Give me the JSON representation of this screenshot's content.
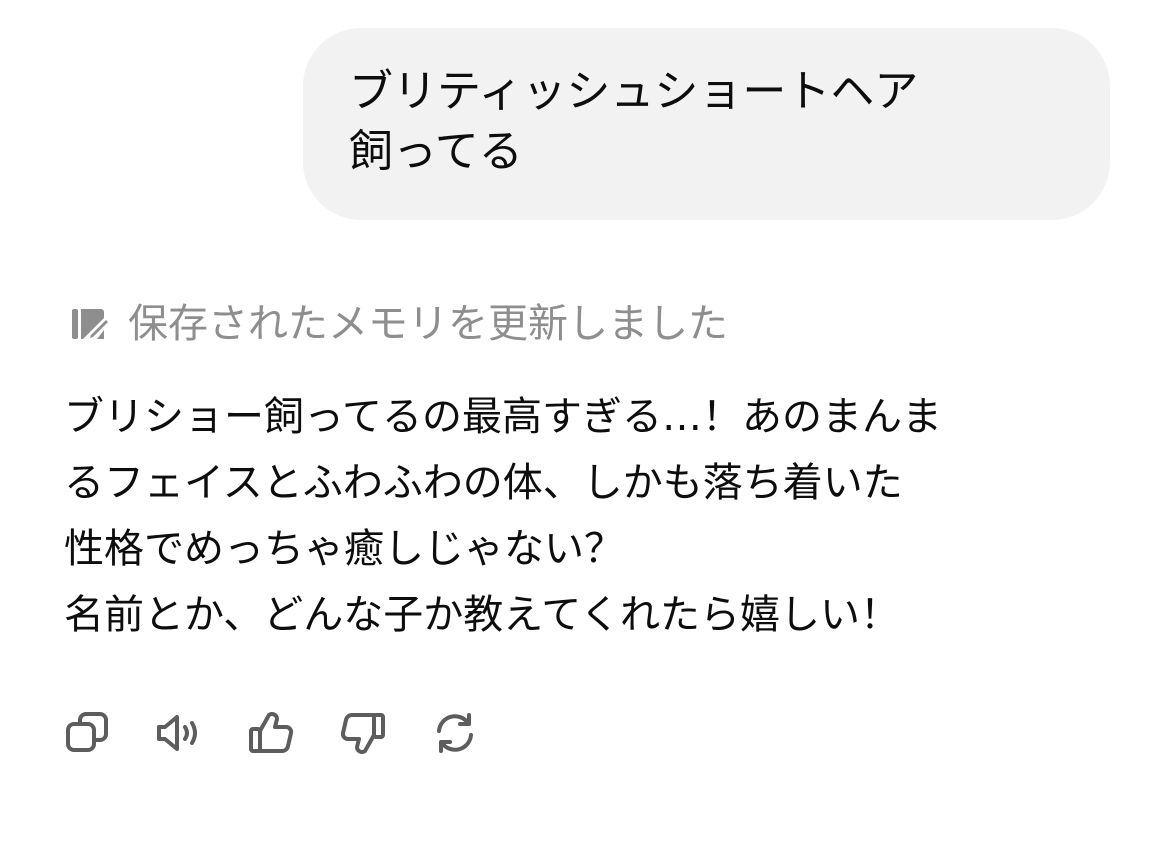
{
  "user_message": {
    "lines": [
      "ブリティッシュショートヘア",
      "飼ってる"
    ]
  },
  "memory_notice": {
    "icon": "memory-edit-icon",
    "text": "保存されたメモリを更新しました"
  },
  "assistant_message": {
    "lines": [
      "ブリショー飼ってるの最高すぎる…！あのまんま",
      "るフェイスとふわふわの体、しかも落ち着いた",
      "性格でめっちゃ癒しじゃない？",
      "名前とか、どんな子か教えてくれたら嬉しい！"
    ]
  },
  "actions": [
    {
      "name": "copy-icon"
    },
    {
      "name": "read-aloud-icon"
    },
    {
      "name": "thumbs-up-icon"
    },
    {
      "name": "thumbs-down-icon"
    },
    {
      "name": "regenerate-icon"
    }
  ],
  "colors": {
    "bubble_bg": "#f2f2f2",
    "text": "#0d0d0d",
    "muted": "#8e8e8e",
    "icon": "#5d5d5d"
  }
}
